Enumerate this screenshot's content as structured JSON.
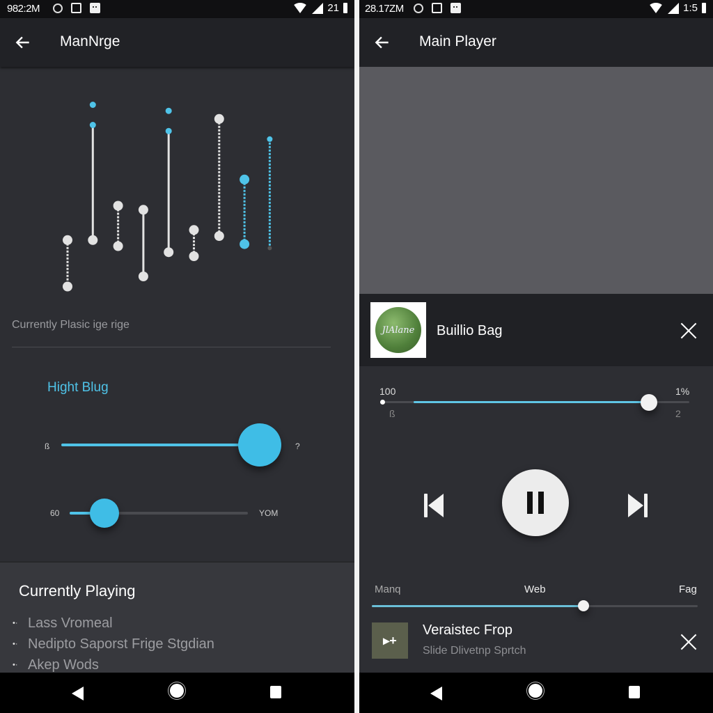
{
  "left": {
    "status": {
      "time": "982:2M",
      "right_text": "21"
    },
    "appbar": {
      "title": "ManNrge",
      "back_icon": "arrow-left-icon"
    },
    "equalizer": {
      "accent": "#4fc3e8",
      "bands": [
        {
          "top": 0.28,
          "bottom": 0.05,
          "color": "white",
          "style": "dotted"
        },
        {
          "top": 0.85,
          "bottom": 0.28,
          "color": "white",
          "style": "solid",
          "extra_dot": 0.95
        },
        {
          "top": 0.45,
          "bottom": 0.25,
          "color": "white",
          "style": "dotted"
        },
        {
          "top": 0.43,
          "bottom": 0.1,
          "color": "white",
          "style": "solid"
        },
        {
          "top": 0.82,
          "bottom": 0.22,
          "color": "white",
          "style": "solid",
          "extra_dot": 0.92
        },
        {
          "top": 0.33,
          "bottom": 0.2,
          "color": "white",
          "style": "dotted"
        },
        {
          "top": 0.88,
          "bottom": 0.3,
          "color": "white",
          "style": "dotted"
        },
        {
          "top": 0.58,
          "bottom": 0.26,
          "color": "blue",
          "style": "dotted"
        },
        {
          "top": 0.78,
          "bottom": 0.24,
          "color": "blue",
          "style": "dotted"
        }
      ]
    },
    "currently_label": "Currently Plasic ige rige",
    "hight_label": "Hight Blug",
    "slider1": {
      "min_label": "ß",
      "max_label": "?",
      "value": 0.9
    },
    "slider2": {
      "min_label": "60",
      "max_label": "YOM",
      "value": 0.2
    },
    "currently_playing": {
      "heading": "Currently Playing",
      "items": [
        "Lass Vromeal",
        "Nedipto Saporst Frige Stgdian",
        "Akep Wods"
      ]
    }
  },
  "right": {
    "status": {
      "time": "28.17ZM",
      "right_text": "1:5"
    },
    "appbar": {
      "title": "Main Player",
      "back_icon": "arrow-left-icon"
    },
    "now_playing": {
      "title": "Buillio Bag",
      "art_text": "JlAlane"
    },
    "volume": {
      "left_label": "100",
      "right_label": "1%",
      "left_sub": "ß",
      "right_sub": "2",
      "value": 0.86
    },
    "controls": {
      "prev": "skip-previous-icon",
      "play": "pause-icon",
      "next": "skip-next-icon"
    },
    "progress": {
      "left_label": "Manq",
      "mid_label": "Web",
      "right_label": "Fag",
      "value": 0.65
    },
    "queue_item": {
      "title": "Veraistec Frop",
      "subtitle": "Slide Dlivetnp Sprtch",
      "thumb_glyph": "▸+"
    }
  }
}
